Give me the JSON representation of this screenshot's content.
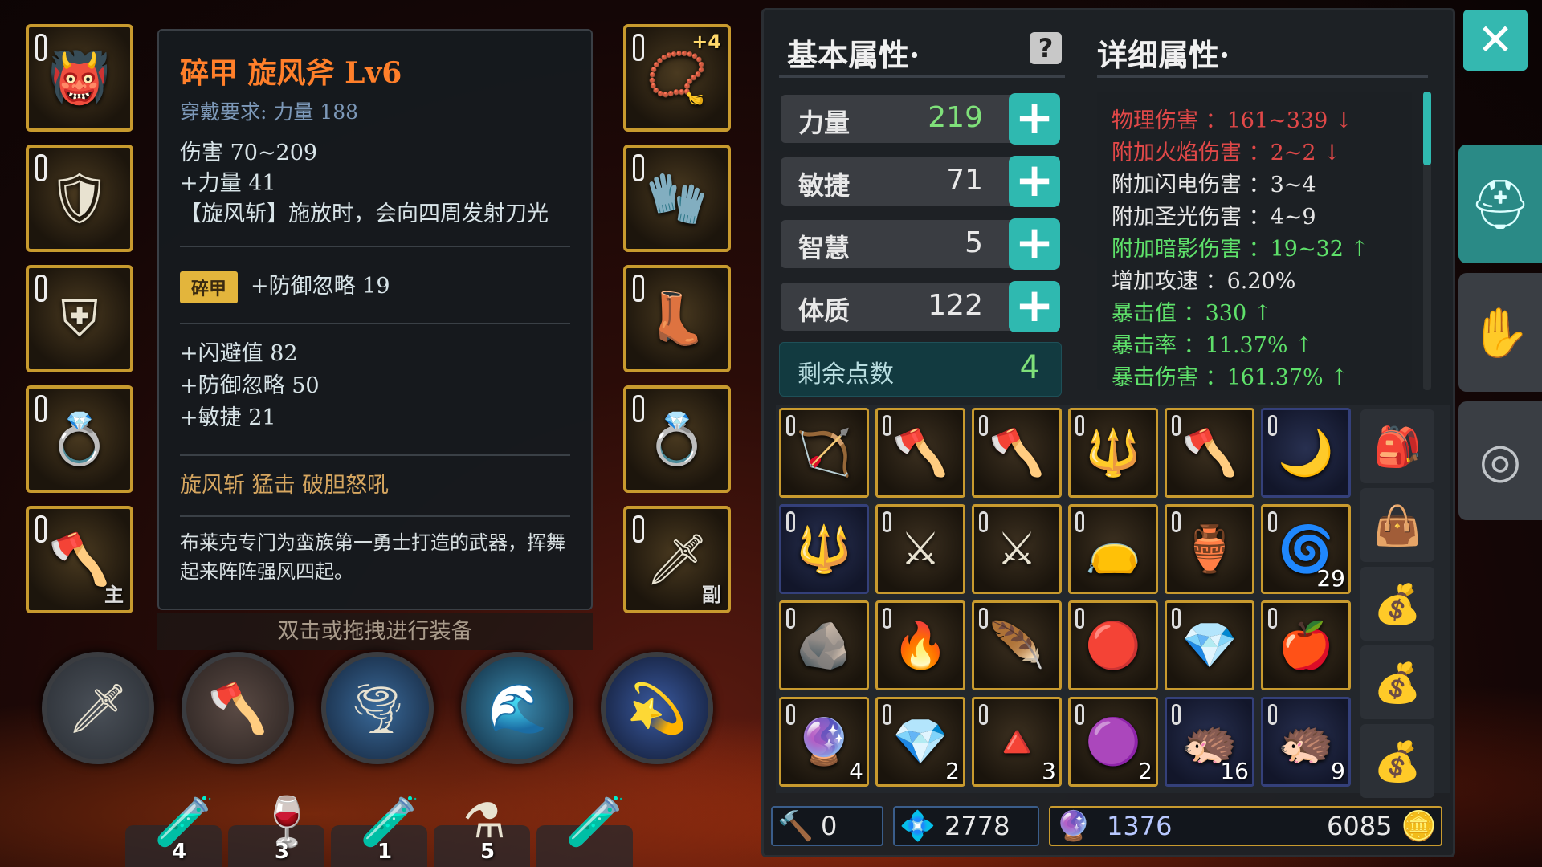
{
  "tooltip": {
    "title": "碎甲 旋风斧 Lv6",
    "requirement": "穿戴要求:  力量 188",
    "damage": "伤害  70~209",
    "str_bonus": "+力量 41",
    "skill_effect": "【旋风斩】施放时，会向四周发射刀光",
    "badge": "碎甲",
    "badge_effect": "+防御忽略 19",
    "bonus1": "+闪避值 82",
    "bonus2": "+防御忽略 50",
    "bonus3": "+敏捷 21",
    "skills": "旋风斩    猛击    破胆怒吼",
    "description": "布莱克专门为蛮族第一勇士打造的武器，挥舞起来阵阵强风四起。"
  },
  "hint": "双击或拖拽进行装备",
  "equip_left": [
    {
      "icon": "helmet-icon",
      "glyph": "👹"
    },
    {
      "icon": "chest-armor-icon",
      "glyph": "🛡"
    },
    {
      "icon": "shoulder-armor-icon",
      "glyph": "⛨"
    },
    {
      "icon": "ring-icon",
      "glyph": "💍"
    },
    {
      "icon": "axe-weapon-icon",
      "glyph": "🪓",
      "tag": "主"
    }
  ],
  "equip_right": [
    {
      "icon": "necklace-icon",
      "glyph": "📿",
      "tagtop": "+4"
    },
    {
      "icon": "gloves-icon",
      "glyph": "🧤"
    },
    {
      "icon": "boots-icon",
      "glyph": "👢"
    },
    {
      "icon": "ring-icon",
      "glyph": "💍"
    },
    {
      "icon": "sword-offhand-icon",
      "glyph": "🗡",
      "tag": "副"
    }
  ],
  "potions": [
    {
      "icon": "green-potion-icon",
      "glyph": "🧪",
      "count": "4"
    },
    {
      "icon": "red-potion-icon",
      "glyph": "🍷",
      "count": "3"
    },
    {
      "icon": "red-vial-icon",
      "glyph": "🧪",
      "count": "1"
    },
    {
      "icon": "red-flask-icon",
      "glyph": "⚗",
      "count": "5"
    },
    {
      "icon": "blue-vial-icon",
      "glyph": "🧪",
      "count": ""
    }
  ],
  "attributes": {
    "basic_header": "基本属性·",
    "detail_header": "详细属性·",
    "stats": [
      {
        "name": "力量",
        "value": "219",
        "green": true
      },
      {
        "name": "敏捷",
        "value": "71",
        "green": false
      },
      {
        "name": "智慧",
        "value": "5",
        "green": false
      },
      {
        "name": "体质",
        "value": "122",
        "green": false
      }
    ],
    "remain_label": "剩余点数",
    "remain_value": "4",
    "details": [
      {
        "text": "物理伤害 ：161~339 ↓",
        "color": "red"
      },
      {
        "text": "附加火焰伤害 ：2~2 ↓",
        "color": "red"
      },
      {
        "text": "附加闪电伤害 ：3~4",
        "color": "white"
      },
      {
        "text": "附加圣光伤害 ：4~9",
        "color": "white"
      },
      {
        "text": "附加暗影伤害 ：19~32 ↑",
        "color": "green"
      },
      {
        "text": "增加攻速 ：6.20%",
        "color": "white"
      },
      {
        "text": "暴击值 ：330 ↑",
        "color": "green"
      },
      {
        "text": "暴击率 ：11.37% ↑",
        "color": "green"
      },
      {
        "text": "暴击伤害 ：161.37% ↑",
        "color": "green"
      }
    ]
  },
  "inventory": [
    {
      "icon": "bow-icon",
      "glyph": "🏹",
      "count": ""
    },
    {
      "icon": "red-axe-icon",
      "glyph": "🪓",
      "count": ""
    },
    {
      "icon": "red-axe-icon",
      "glyph": "🪓",
      "count": ""
    },
    {
      "icon": "blue-mace-icon",
      "glyph": "🔱",
      "count": ""
    },
    {
      "icon": "halberd-icon",
      "glyph": "🪓",
      "count": ""
    },
    {
      "icon": "scythe-icon",
      "glyph": "🌙",
      "count": "",
      "blue": true
    },
    {
      "icon": "spear-icon",
      "glyph": "🔱",
      "count": "",
      "blue": true
    },
    {
      "icon": "double-axe-icon",
      "glyph": "⚔",
      "count": ""
    },
    {
      "icon": "double-axe-icon",
      "glyph": "⚔",
      "count": ""
    },
    {
      "icon": "pouch-icon",
      "glyph": "👝",
      "count": ""
    },
    {
      "icon": "purple-jar-icon",
      "glyph": "🏺",
      "count": ""
    },
    {
      "icon": "swirl-orb-icon",
      "glyph": "🌀",
      "count": "29"
    },
    {
      "icon": "coal-ore-icon",
      "glyph": "🪨",
      "count": ""
    },
    {
      "icon": "fire-crystal-icon",
      "glyph": "🔥",
      "count": ""
    },
    {
      "icon": "red-feather-icon",
      "glyph": "🪶",
      "count": ""
    },
    {
      "icon": "flesh-orb-icon",
      "glyph": "🔴",
      "count": ""
    },
    {
      "icon": "red-crystal-icon",
      "glyph": "💎",
      "count": ""
    },
    {
      "icon": "red-gem-icon",
      "glyph": "🍎",
      "count": ""
    },
    {
      "icon": "purple-ore-icon",
      "glyph": "🔮",
      "count": "4"
    },
    {
      "icon": "ruby-ore-icon",
      "glyph": "💎",
      "count": "2"
    },
    {
      "icon": "red-shard-icon",
      "glyph": "🔺",
      "count": "3"
    },
    {
      "icon": "magenta-orb-icon",
      "glyph": "🟣",
      "count": "2"
    },
    {
      "icon": "brown-fur-icon",
      "glyph": "🦔",
      "count": "16",
      "blue": true
    },
    {
      "icon": "dark-fur-icon",
      "glyph": "🦔",
      "count": "9",
      "blue": true
    }
  ],
  "bags": [
    {
      "icon": "backpack-icon",
      "glyph": "🎒"
    },
    {
      "icon": "small-bag-icon",
      "glyph": "👜"
    },
    {
      "icon": "sack-icon",
      "glyph": "💰"
    },
    {
      "icon": "sack-icon",
      "glyph": "💰"
    },
    {
      "icon": "sack-icon",
      "glyph": "💰"
    }
  ],
  "currency": {
    "hammer": "0",
    "gems": "2778",
    "crystals": "1376",
    "gold": "6085"
  },
  "side_tabs": [
    {
      "icon": "helmet-tab-icon",
      "glyph": "⛑"
    },
    {
      "icon": "glove-tab-icon",
      "glyph": "✋"
    },
    {
      "icon": "target-tab-icon",
      "glyph": "◎"
    }
  ],
  "colors": {
    "accent": "#34b8b0",
    "gold_border": "#c89a2e",
    "title": "#ff7f2a"
  }
}
